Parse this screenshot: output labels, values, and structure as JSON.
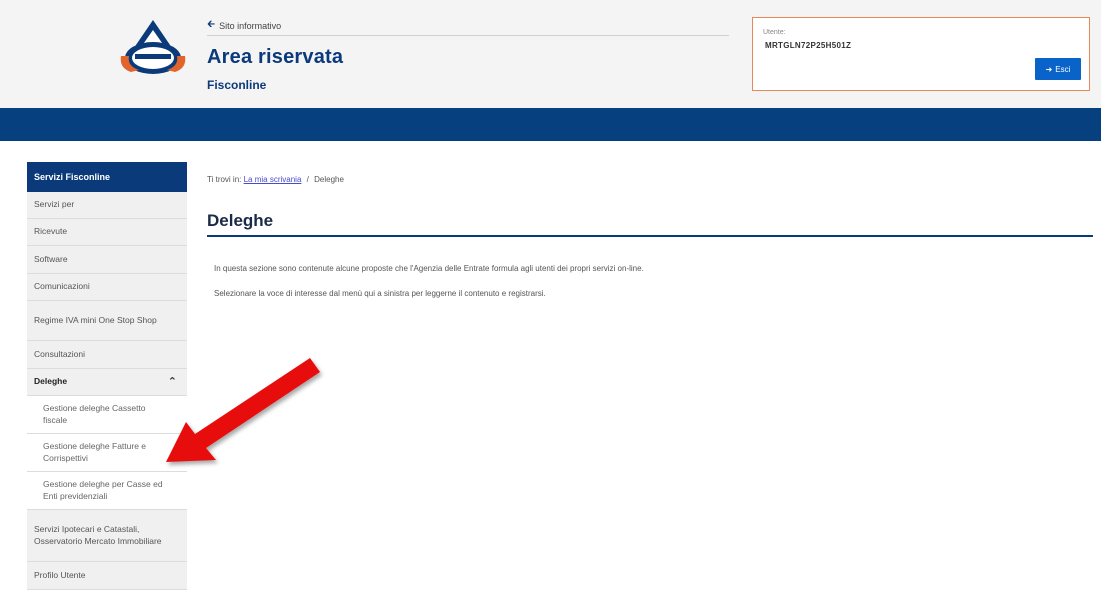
{
  "header": {
    "site_link": "Sito informativo",
    "title": "Area riservata",
    "subtitle": "Fisconline",
    "user_label": "Utente:",
    "user_code": "MRTGLN72P25H501Z",
    "logout_label": "Esci",
    "logout_icon": "logout-icon",
    "logo_icon": "agenzia-entrate-logo"
  },
  "sidebar": {
    "head": "Servizi Fisconline",
    "items": [
      {
        "label": "Servizi per"
      },
      {
        "label": "Ricevute"
      },
      {
        "label": "Software"
      },
      {
        "label": "Comunicazioni"
      },
      {
        "label": "Regime IVA mini One Stop Shop"
      },
      {
        "label": "Consultazioni"
      },
      {
        "label": "Deleghe"
      }
    ],
    "subitems": [
      {
        "label": "Gestione deleghe Cassetto fiscale"
      },
      {
        "label": "Gestione deleghe Fatture e Corrispettivi"
      },
      {
        "label": "Gestione deleghe per Casse ed Enti previdenziali"
      }
    ],
    "after_items": [
      {
        "label": "Servizi Ipotecari e Catastali, Osservatorio Mercato Immobiliare"
      },
      {
        "label": "Profilo Utente"
      }
    ]
  },
  "main": {
    "breadcrumb_prefix": "Ti trovi in:",
    "breadcrumb_link": "La mia scrivania",
    "breadcrumb_sep": "/",
    "breadcrumb_current": "Deleghe",
    "page_title": "Deleghe",
    "para1": "In questa sezione sono contenute alcune proposte che l'Agenzia delle Entrate formula agli utenti dei propri servizi on-line.",
    "para2": "Selezionare la voce di interesse dal menù qui a sinistra per leggerne il contenuto e registrarsi."
  },
  "colors": {
    "brand_blue": "#0b3a7a",
    "bar_blue": "#06407f",
    "button_blue": "#0a63c9",
    "user_box_border": "#e8885a",
    "arrow_red": "#e8100e"
  }
}
